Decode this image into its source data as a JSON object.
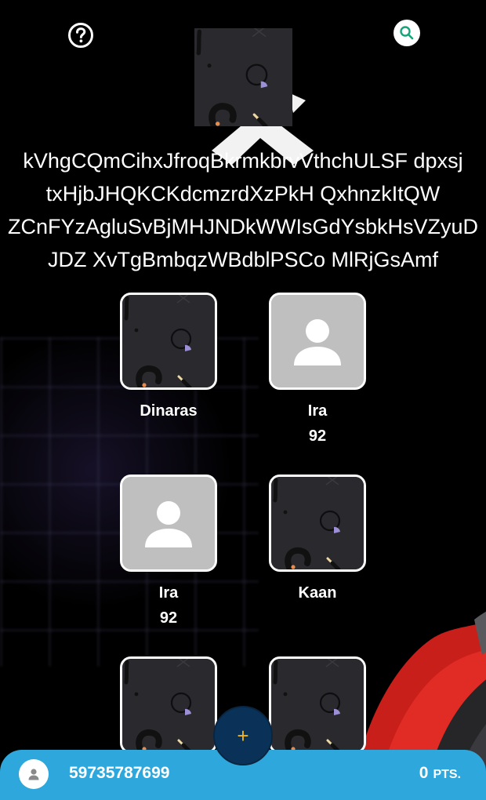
{
  "header": {
    "help_icon": "help-circle-icon",
    "search_icon": "search-icon",
    "accent_color": "#1aa37a"
  },
  "group": {
    "title_lines": [
      "kVhgCQmCihxJfroqBkrmkbrvVthchULSF dpxsj",
      "txHjbJHQKCKdcmzrdXzPkH QxhnzkItQW",
      "ZCnFYzAgluSvBjMHJNDkWWIsGdYsbkHsVZyuD",
      "JDZ XvTgBmbqzWBdblPSCo MlRjGsAmf"
    ]
  },
  "members": [
    {
      "name": "Dinaras",
      "score": "",
      "avatar": "pattern-avatar"
    },
    {
      "name": "Ira",
      "score": "92",
      "avatar": "default-person-avatar"
    },
    {
      "name": "Ira",
      "score": "92",
      "avatar": "default-person-avatar"
    },
    {
      "name": "Kaan",
      "score": "",
      "avatar": "pattern-avatar"
    },
    {
      "name": "",
      "score": "",
      "avatar": "pattern-avatar"
    },
    {
      "name": "",
      "score": "",
      "avatar": "pattern-avatar"
    }
  ],
  "fab": {
    "label": "+",
    "color": "#f2b318",
    "background": "#0a3258"
  },
  "footer": {
    "phone": "59735787699",
    "points_value": "0",
    "points_unit": "PTS.",
    "bar_color": "#2ea8dc",
    "user_icon": "user-icon"
  }
}
